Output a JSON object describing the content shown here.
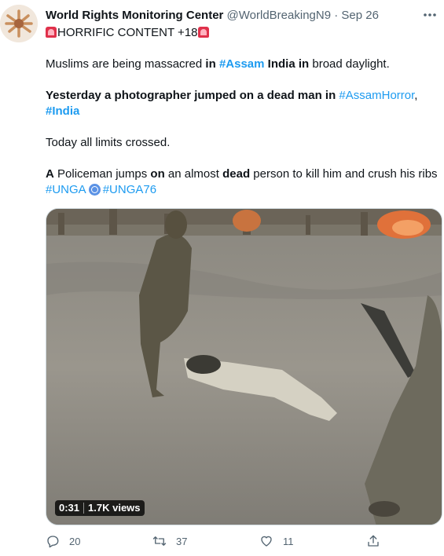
{
  "tweet": {
    "author_name": "World Rights Monitoring Center",
    "author_handle": "@WorldBreakingN9",
    "separator": "·",
    "date": "Sep 26",
    "warning_text": "HORRIFIC CONTENT +18",
    "line1_a": "Muslims are being massacred ",
    "line1_in": "in",
    "line1_tag": "#Assam",
    "line1_india": "India",
    "line1_in2": "in",
    "line1_rest": " broad daylight.",
    "line2_a": "Yesterday a photographer jumped on a dead man in ",
    "line2_tag1": "#AssamHorror",
    "line2_comma": ",",
    "line2_tag2": "#India",
    "line3": "Today all limits crossed.",
    "line4_a": "A",
    "line4_b": " Policeman jumps ",
    "line4_on": "on",
    "line4_c": " an almost ",
    "line4_dead": "dead",
    "line4_d": " person to kill him and crush his ribs",
    "tag_unga": "#UNGA",
    "tag_unga76": "#UNGA76"
  },
  "media": {
    "duration": "0:31",
    "views": "1.7K views"
  },
  "actions": {
    "reply_count": "20",
    "retweet_count": "37",
    "like_count": "11"
  },
  "icons": {
    "more": "more-horizontal-icon",
    "reply": "reply-icon",
    "retweet": "retweet-icon",
    "like": "heart-icon",
    "share": "share-icon"
  },
  "colors": {
    "link": "#1d9bf0",
    "secondary_text": "#536471",
    "siren_red": "#e0314b"
  }
}
